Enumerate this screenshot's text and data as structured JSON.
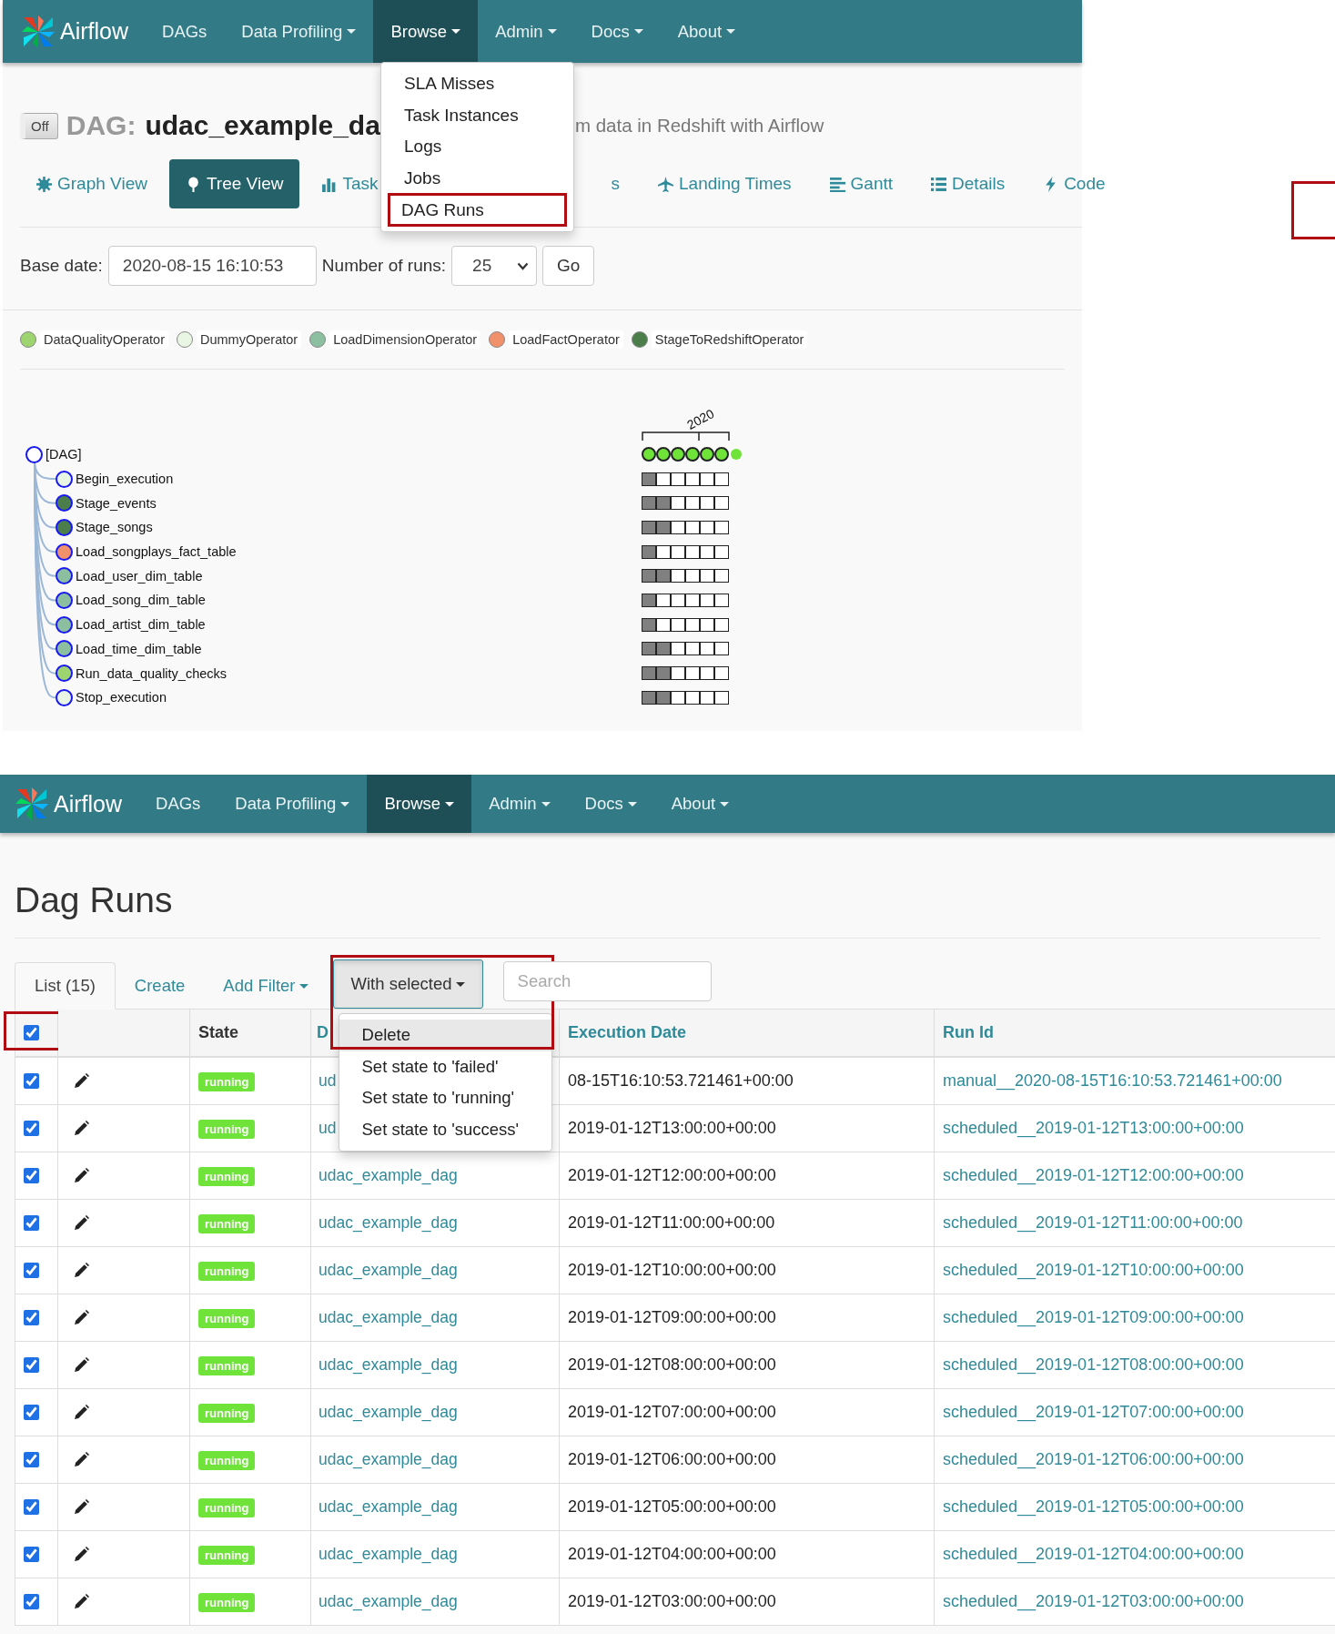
{
  "top_window": {
    "navbar": {
      "brand": "Airflow",
      "items": [
        {
          "label": "DAGs",
          "dropdown": false,
          "selected": false
        },
        {
          "label": "Data Profiling",
          "dropdown": true,
          "selected": false
        },
        {
          "label": "Browse",
          "dropdown": true,
          "selected": true
        },
        {
          "label": "Admin",
          "dropdown": true,
          "selected": false
        },
        {
          "label": "Docs",
          "dropdown": true,
          "selected": false
        },
        {
          "label": "About",
          "dropdown": true,
          "selected": false
        }
      ]
    },
    "browse_menu": [
      {
        "label": "SLA Misses",
        "highlighted": false
      },
      {
        "label": "Task Instances",
        "highlighted": false
      },
      {
        "label": "Logs",
        "highlighted": false
      },
      {
        "label": "Jobs",
        "highlighted": false
      },
      {
        "label": "DAG Runs",
        "highlighted": true
      }
    ],
    "dag_header": {
      "toggle": "Off",
      "prefix": "DAG:",
      "dag_id": "udac_example_da",
      "description": "m data in Redshift with Airflow"
    },
    "view_tabs": [
      {
        "label": "Graph View",
        "selected": false
      },
      {
        "label": "Tree View",
        "selected": true
      },
      {
        "label": "Task",
        "selected": false
      },
      {
        "label": "s",
        "selected": false
      },
      {
        "label": "Landing Times",
        "selected": false
      },
      {
        "label": "Gantt",
        "selected": false
      },
      {
        "label": "Details",
        "selected": false
      },
      {
        "label": "Code",
        "selected": false
      }
    ],
    "form": {
      "base_date_label": "Base date:",
      "base_date": "2020-08-15 16:10:53",
      "runs_label": "Number of runs:",
      "runs": "25",
      "go": "Go"
    },
    "legend": [
      {
        "label": "DataQualityOperator",
        "color": "#9ed46f"
      },
      {
        "label": "DummyOperator",
        "color": "#e8f6e3"
      },
      {
        "label": "LoadDimensionOperator",
        "color": "#8bbfa0"
      },
      {
        "label": "LoadFactOperator",
        "color": "#f0916c"
      },
      {
        "label": "StageToRedshiftOperator",
        "color": "#4b7e4b"
      }
    ],
    "tree": {
      "year": "2020",
      "root": {
        "label": "[DAG]",
        "runs": [
          {
            "kind": "run"
          },
          {
            "kind": "run"
          },
          {
            "kind": "run"
          },
          {
            "kind": "run"
          },
          {
            "kind": "run"
          },
          {
            "kind": "run"
          },
          {
            "kind": "marker"
          }
        ],
        "children": [
          {
            "label": "Begin_execution",
            "color": "#e8f6e3",
            "runs": [
              {
                "filled": true
              },
              {
                "filled": false
              },
              {
                "filled": false
              },
              {
                "filled": false
              },
              {
                "filled": false
              },
              {
                "filled": false
              }
            ]
          },
          {
            "label": "Stage_events",
            "color": "#4b7e4b",
            "runs": [
              {
                "filled": true
              },
              {
                "filled": true
              },
              {
                "filled": false
              },
              {
                "filled": false
              },
              {
                "filled": false
              },
              {
                "filled": false
              }
            ]
          },
          {
            "label": "Stage_songs",
            "color": "#4b7e4b",
            "runs": [
              {
                "filled": true
              },
              {
                "filled": true
              },
              {
                "filled": false
              },
              {
                "filled": false
              },
              {
                "filled": false
              },
              {
                "filled": false
              }
            ]
          },
          {
            "label": "Load_songplays_fact_table",
            "color": "#f0916c",
            "runs": [
              {
                "filled": true
              },
              {
                "filled": false
              },
              {
                "filled": false
              },
              {
                "filled": false
              },
              {
                "filled": false
              },
              {
                "filled": false
              }
            ]
          },
          {
            "label": "Load_user_dim_table",
            "color": "#8bbfa0",
            "runs": [
              {
                "filled": true
              },
              {
                "filled": true
              },
              {
                "filled": false
              },
              {
                "filled": false
              },
              {
                "filled": false
              },
              {
                "filled": false
              }
            ]
          },
          {
            "label": "Load_song_dim_table",
            "color": "#8bbfa0",
            "runs": [
              {
                "filled": true
              },
              {
                "filled": false
              },
              {
                "filled": false
              },
              {
                "filled": false
              },
              {
                "filled": false
              },
              {
                "filled": false
              }
            ]
          },
          {
            "label": "Load_artist_dim_table",
            "color": "#8bbfa0",
            "runs": [
              {
                "filled": true
              },
              {
                "filled": false
              },
              {
                "filled": false
              },
              {
                "filled": false
              },
              {
                "filled": false
              },
              {
                "filled": false
              }
            ]
          },
          {
            "label": "Load_time_dim_table",
            "color": "#8bbfa0",
            "runs": [
              {
                "filled": true
              },
              {
                "filled": true
              },
              {
                "filled": false
              },
              {
                "filled": false
              },
              {
                "filled": false
              },
              {
                "filled": false
              }
            ]
          },
          {
            "label": "Run_data_quality_checks",
            "color": "#9ed46f",
            "runs": [
              {
                "filled": true
              },
              {
                "filled": true
              },
              {
                "filled": false
              },
              {
                "filled": false
              },
              {
                "filled": false
              },
              {
                "filled": false
              }
            ]
          },
          {
            "label": "Stop_execution",
            "color": "#e8f6e3",
            "runs": [
              {
                "filled": true
              },
              {
                "filled": true
              },
              {
                "filled": false
              },
              {
                "filled": false
              },
              {
                "filled": false
              },
              {
                "filled": false
              }
            ]
          }
        ]
      }
    }
  },
  "bottom_window": {
    "navbar": {
      "brand": "Airflow",
      "items": [
        {
          "label": "DAGs",
          "dropdown": false,
          "selected": false
        },
        {
          "label": "Data Profiling",
          "dropdown": true,
          "selected": false
        },
        {
          "label": "Browse",
          "dropdown": true,
          "selected": true
        },
        {
          "label": "Admin",
          "dropdown": true,
          "selected": false
        },
        {
          "label": "Docs",
          "dropdown": true,
          "selected": false
        },
        {
          "label": "About",
          "dropdown": true,
          "selected": false
        }
      ]
    },
    "title": "Dag Runs",
    "list_tabs": [
      {
        "label": "List (15)",
        "selected": true,
        "dropdown": false
      },
      {
        "label": "Create",
        "selected": false,
        "dropdown": false
      },
      {
        "label": "Add Filter",
        "selected": false,
        "dropdown": true
      }
    ],
    "with_selected": {
      "label": "With selected",
      "expanded": true,
      "highlighted": true
    },
    "search": {
      "placeholder": "Search"
    },
    "actions_menu": [
      {
        "label": "Delete",
        "selected": true
      },
      {
        "label": "Set state to 'failed'",
        "selected": false
      },
      {
        "label": "Set state to 'running'",
        "selected": false
      },
      {
        "label": "Set state to 'success'",
        "selected": false
      }
    ],
    "table": {
      "select_all": {
        "checked": true,
        "highlighted": true
      },
      "columns": [
        {
          "label": "State",
          "sortable": false
        },
        {
          "label": "D",
          "sortable": true
        },
        {
          "label": "Execution Date",
          "sortable": true
        },
        {
          "label": "Run Id",
          "sortable": true
        }
      ],
      "rows": [
        {
          "checked": true,
          "state": "running",
          "dag_id": "ud",
          "execution_date": "08-15T16:10:53.721461+00:00",
          "run_id": "manual__2020-08-15T16:10:53.721461+00:00"
        },
        {
          "checked": true,
          "state": "running",
          "dag_id": "ud",
          "execution_date": "2019-01-12T13:00:00+00:00",
          "run_id": "scheduled__2019-01-12T13:00:00+00:00"
        },
        {
          "checked": true,
          "state": "running",
          "dag_id": "udac_example_dag",
          "execution_date": "2019-01-12T12:00:00+00:00",
          "run_id": "scheduled__2019-01-12T12:00:00+00:00"
        },
        {
          "checked": true,
          "state": "running",
          "dag_id": "udac_example_dag",
          "execution_date": "2019-01-12T11:00:00+00:00",
          "run_id": "scheduled__2019-01-12T11:00:00+00:00"
        },
        {
          "checked": true,
          "state": "running",
          "dag_id": "udac_example_dag",
          "execution_date": "2019-01-12T10:00:00+00:00",
          "run_id": "scheduled__2019-01-12T10:00:00+00:00"
        },
        {
          "checked": true,
          "state": "running",
          "dag_id": "udac_example_dag",
          "execution_date": "2019-01-12T09:00:00+00:00",
          "run_id": "scheduled__2019-01-12T09:00:00+00:00"
        },
        {
          "checked": true,
          "state": "running",
          "dag_id": "udac_example_dag",
          "execution_date": "2019-01-12T08:00:00+00:00",
          "run_id": "scheduled__2019-01-12T08:00:00+00:00"
        },
        {
          "checked": true,
          "state": "running",
          "dag_id": "udac_example_dag",
          "execution_date": "2019-01-12T07:00:00+00:00",
          "run_id": "scheduled__2019-01-12T07:00:00+00:00"
        },
        {
          "checked": true,
          "state": "running",
          "dag_id": "udac_example_dag",
          "execution_date": "2019-01-12T06:00:00+00:00",
          "run_id": "scheduled__2019-01-12T06:00:00+00:00"
        },
        {
          "checked": true,
          "state": "running",
          "dag_id": "udac_example_dag",
          "execution_date": "2019-01-12T05:00:00+00:00",
          "run_id": "scheduled__2019-01-12T05:00:00+00:00"
        },
        {
          "checked": true,
          "state": "running",
          "dag_id": "udac_example_dag",
          "execution_date": "2019-01-12T04:00:00+00:00",
          "run_id": "scheduled__2019-01-12T04:00:00+00:00"
        },
        {
          "checked": true,
          "state": "running",
          "dag_id": "udac_example_dag",
          "execution_date": "2019-01-12T03:00:00+00:00",
          "run_id": "scheduled__2019-01-12T03:00:00+00:00"
        }
      ]
    }
  }
}
